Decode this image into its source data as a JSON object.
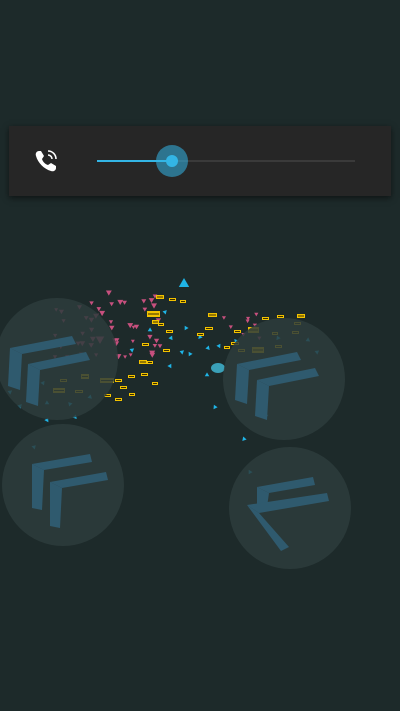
{
  "volume": {
    "icon": "phone-call-icon",
    "level": 0.29,
    "accent_color": "#33b5e5"
  },
  "colors": {
    "background": "#1d2a2a",
    "panel": "#262626",
    "joystick": "#2d3c3c",
    "chevron": "#2f5a6e",
    "enemy_pink": "#c7507e",
    "player_cyan": "#1fb4e6",
    "score_yellow": "#f2c200"
  },
  "joysticks": [
    {
      "name": "left-top-joystick",
      "icon": "chevron-icon"
    },
    {
      "name": "right-top-joystick",
      "icon": "chevron-icon"
    },
    {
      "name": "left-bottom-joystick",
      "icon": "chevron-icon"
    },
    {
      "name": "right-bottom-joystick",
      "icon": "chevron-icon"
    }
  ]
}
